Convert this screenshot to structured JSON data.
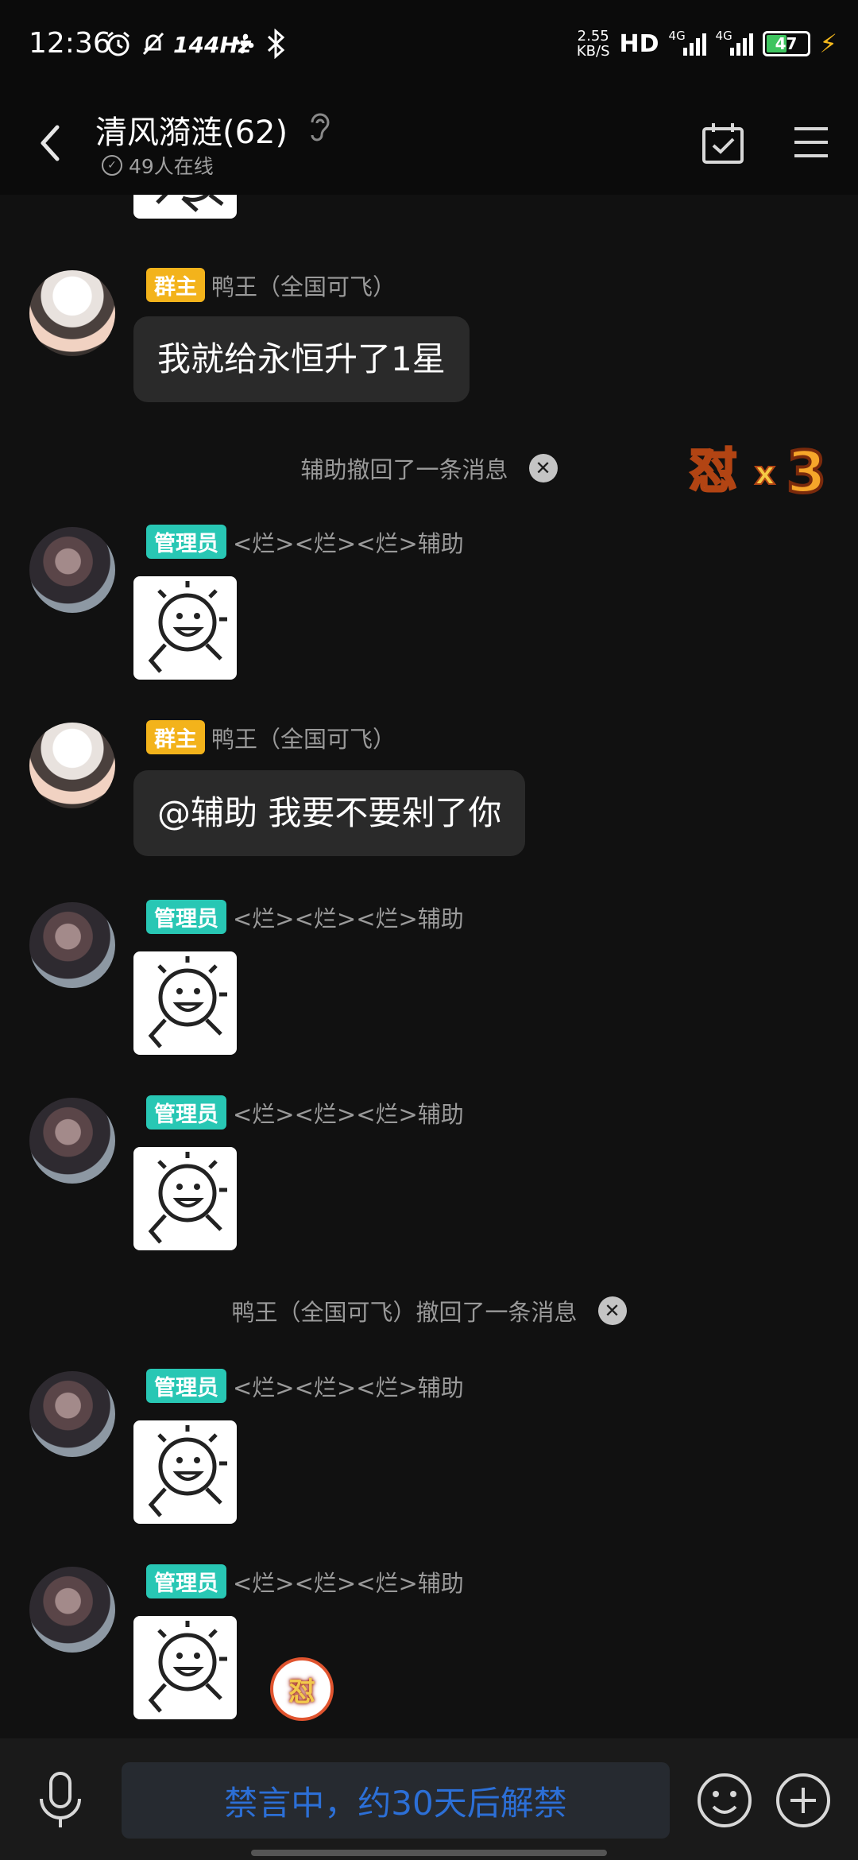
{
  "status_bar": {
    "time": "12:36",
    "refresh_rate": "144Hz",
    "net_speed_value": "2.55",
    "net_speed_unit": "KB/S",
    "hd": "HD",
    "sim1_label": "4G",
    "sim2_label": "4G",
    "battery": "47"
  },
  "header": {
    "title": "清风漪涟(62)",
    "online": "49人在线"
  },
  "messages": {
    "m1": {
      "role_badge": "群主",
      "sender": "鸭王（全国可飞）",
      "text": "我就给永恒升了1星"
    },
    "sys1": {
      "text": "辅助撤回了一条消息"
    },
    "m2": {
      "role_badge": "管理员",
      "sender": "<烂><烂><烂>辅助"
    },
    "m3": {
      "role_badge": "群主",
      "sender": "鸭王（全国可飞）",
      "text": "@辅助 我要不要剁了你"
    },
    "m4": {
      "role_badge": "管理员",
      "sender": "<烂><烂><烂>辅助"
    },
    "m5": {
      "role_badge": "管理员",
      "sender": "<烂><烂><烂>辅助"
    },
    "sys2": {
      "text": "鸭王（全国可飞）撤回了一条消息"
    },
    "m6": {
      "role_badge": "管理员",
      "sender": "<烂><烂><烂>辅助"
    },
    "m7": {
      "role_badge": "管理员",
      "sender": "<烂><烂><烂>辅助"
    }
  },
  "combo_effect": {
    "glyph": "怼",
    "times": "x",
    "count": "3"
  },
  "reaction_ball": {
    "glyph": "怼"
  },
  "input": {
    "muted_text": "禁言中，约30天后解禁"
  },
  "colors": {
    "owner_badge": "#f3b31b",
    "admin_badge": "#28c7b4",
    "muted_text": "#2c6fd6",
    "background": "#111111"
  },
  "icons": [
    "alarm-icon",
    "mute-bell-icon",
    "fan-icon",
    "bluetooth-icon",
    "back-arrow-icon",
    "ear-icon",
    "calendar-check-icon",
    "menu-icon",
    "close-circle-icon",
    "microphone-icon",
    "emoji-icon",
    "plus-icon"
  ]
}
